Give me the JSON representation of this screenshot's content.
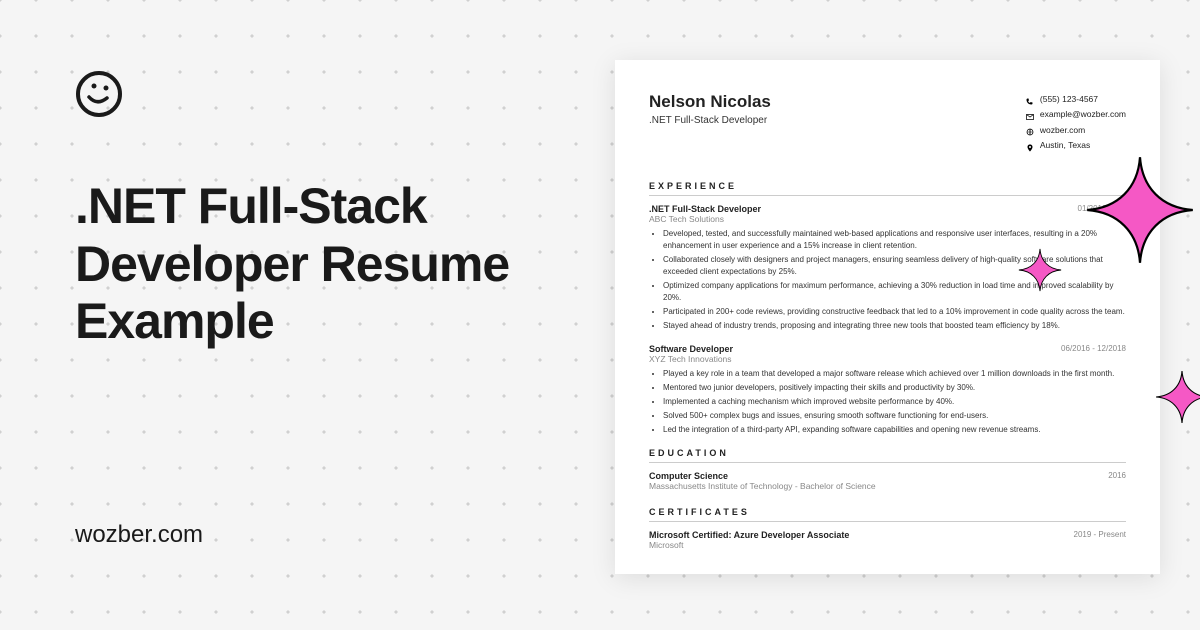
{
  "headline": ".NET Full-Stack Developer Resume Example",
  "site_url": "wozber.com",
  "resume": {
    "name": "Nelson Nicolas",
    "title": ".NET Full-Stack Developer",
    "contact": {
      "phone": "(555) 123-4567",
      "email": "example@wozber.com",
      "website": "wozber.com",
      "location": "Austin, Texas"
    },
    "sections": {
      "experience_heading": "EXPERIENCE",
      "education_heading": "EDUCATION",
      "certificates_heading": "CERTIFICATES"
    },
    "jobs": [
      {
        "title": ".NET Full-Stack Developer",
        "company": "ABC Tech Solutions",
        "dates": "01/2019 - Pre",
        "bullets": [
          "Developed, tested, and successfully maintained web-based applications and responsive user interfaces, resulting in a 20% enhancement in user experience and a 15% increase in client retention.",
          "Collaborated closely with designers and project managers, ensuring seamless delivery of high-quality software solutions that exceeded client expectations by 25%.",
          "Optimized company applications for maximum performance, achieving a 30% reduction in load time and improved scalability by 20%.",
          "Participated in 200+ code reviews, providing constructive feedback that led to a 10% improvement in code quality across the team.",
          "Stayed ahead of industry trends, proposing and integrating three new tools that boosted team efficiency by 18%."
        ]
      },
      {
        "title": "Software Developer",
        "company": "XYZ Tech Innovations",
        "dates": "06/2016 - 12/2018",
        "bullets": [
          "Played a key role in a team that developed a major software release which achieved over 1 million downloads in the first month.",
          "Mentored two junior developers, positively impacting their skills and productivity by 30%.",
          "Implemented a caching mechanism which improved website performance by 40%.",
          "Solved 500+ complex bugs and issues, ensuring smooth software functioning for end-users.",
          "Led the integration of a third-party API, expanding software capabilities and opening new revenue streams."
        ]
      }
    ],
    "education": {
      "degree": "Computer Science",
      "school": "Massachusetts Institute of Technology - Bachelor of Science",
      "year": "2016"
    },
    "certificates": [
      {
        "name": "Microsoft Certified: Azure Developer Associate",
        "issuer": "Microsoft",
        "dates": "2019 - Present"
      }
    ]
  }
}
